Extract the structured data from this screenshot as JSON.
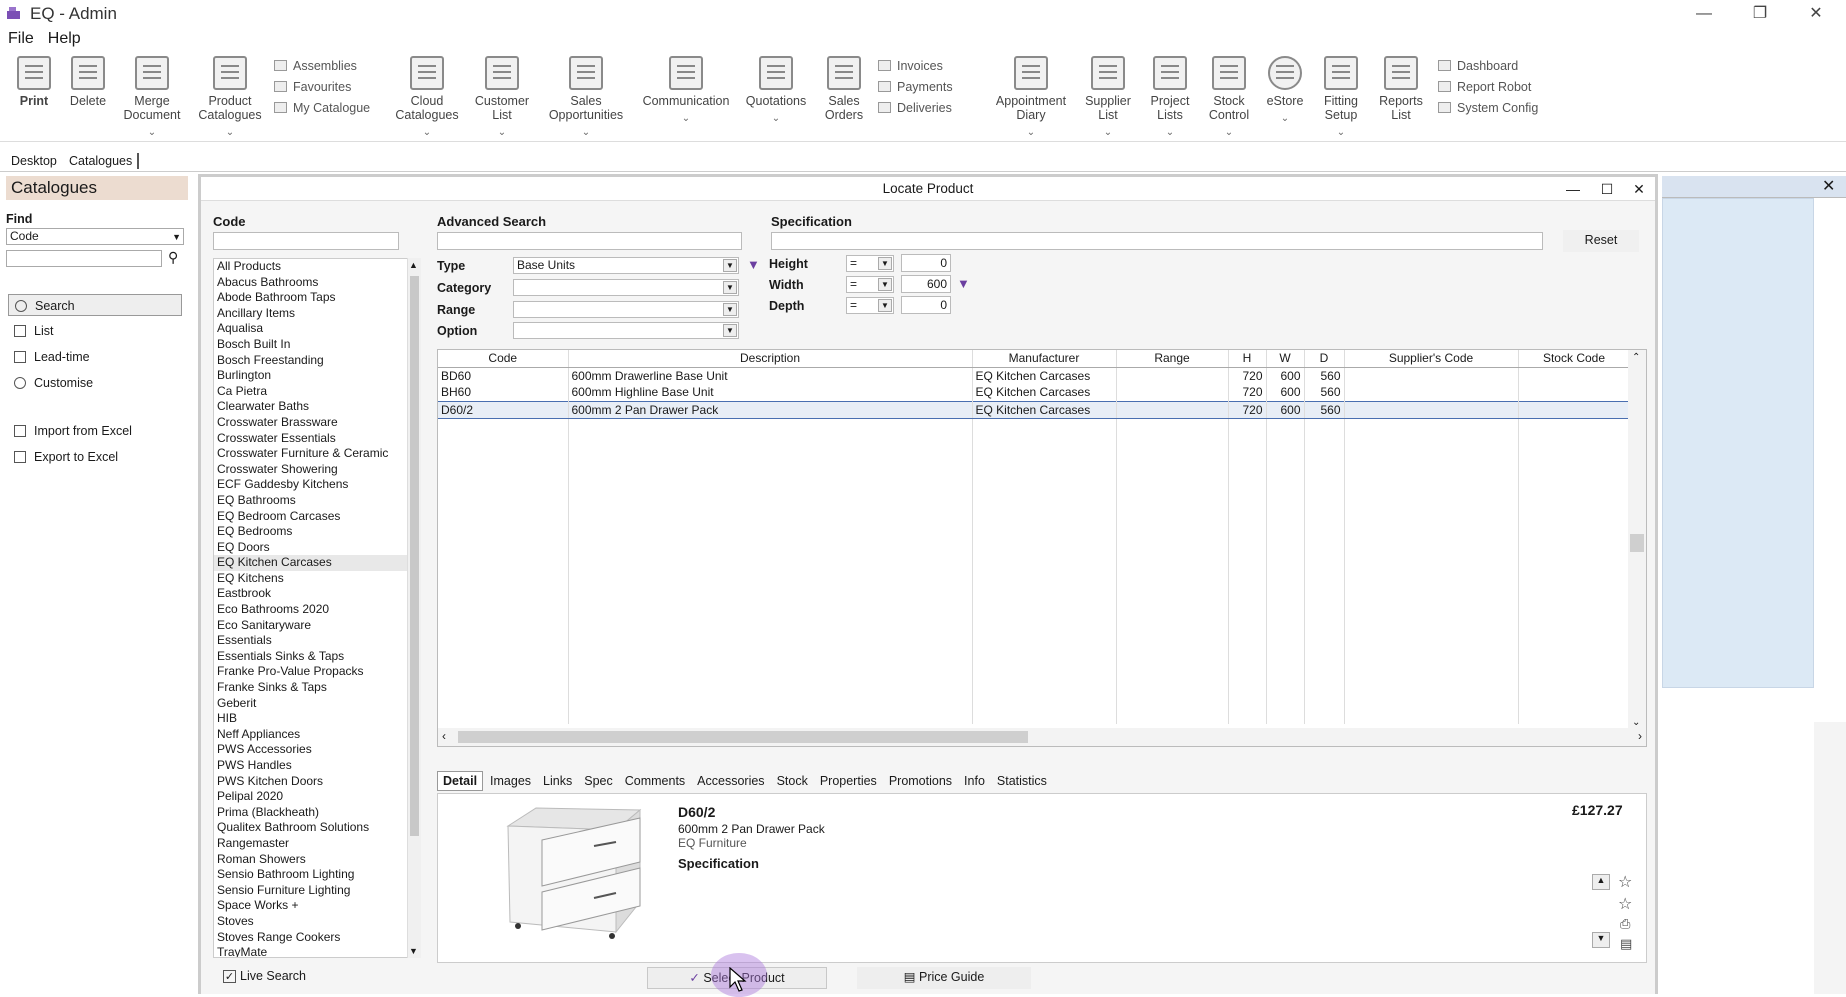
{
  "window": {
    "title": "EQ - Admin",
    "minimize": "—",
    "restore": "❐",
    "close": "✕"
  },
  "menu": [
    "File",
    "Help"
  ],
  "ribbon": {
    "print": "Print",
    "delete": "Delete",
    "merge": "Merge Document",
    "product_catalogues": "Product Catalogues",
    "assemblies": "Assemblies",
    "favourites": "Favourites",
    "my_catalogue": "My Catalogue",
    "cloud": "Cloud Catalogues",
    "customer": "Customer List",
    "sales_opp": "Sales Opportunities",
    "communication": "Communication",
    "quotations": "Quotations",
    "sales_orders": "Sales Orders",
    "invoices": "Invoices",
    "payments": "Payments",
    "deliveries": "Deliveries",
    "appointment": "Appointment Diary",
    "supplier": "Supplier List",
    "project": "Project Lists",
    "stock": "Stock Control",
    "estore": "eStore",
    "fitting": "Fitting Setup",
    "reports": "Reports List",
    "dashboard": "Dashboard",
    "report_robot": "Report Robot",
    "system_config": "System Config"
  },
  "doc_tabs": [
    "Desktop",
    "Catalogues"
  ],
  "left": {
    "title": "Catalogues",
    "find_label": "Find",
    "find_value": "Code",
    "search": "Search",
    "list": "List",
    "lead_time": "Lead-time",
    "customise": "Customise",
    "import": "Import from Excel",
    "export": "Export to Excel"
  },
  "dialog": {
    "title": "Locate Product",
    "code_label": "Code",
    "advanced_label": "Advanced Search",
    "spec_label": "Specification",
    "reset": "Reset",
    "type_label": "Type",
    "type_value": "Base Units",
    "category_label": "Category",
    "range_label": "Range",
    "option_label": "Option",
    "height_label": "Height",
    "width_label": "Width",
    "depth_label": "Depth",
    "eq": "=",
    "height_value": "0",
    "width_value": "600",
    "depth_value": "0",
    "live_search": "Live Search",
    "select_product": "Select Product",
    "price_guide": "Price Guide"
  },
  "code_list": [
    "All Products",
    "Abacus Bathrooms",
    "Abode Bathroom Taps",
    "Ancillary Items",
    "Aqualisa",
    "Bosch Built In",
    "Bosch Freestanding",
    "Burlington",
    "Ca Pietra",
    "Clearwater Baths",
    "Crosswater Brassware",
    "Crosswater Essentials",
    "Crosswater Furniture & Ceramic",
    "Crosswater Showering",
    "ECF Gaddesby Kitchens",
    "EQ Bathrooms",
    "EQ Bedroom Carcases",
    "EQ Bedrooms",
    "EQ Doors",
    "EQ Kitchen Carcases",
    "EQ Kitchens",
    "Eastbrook",
    "Eco Bathrooms 2020",
    "Eco Sanitaryware",
    "Essentials",
    "Essentials Sinks & Taps",
    "Franke Pro-Value Propacks",
    "Franke Sinks & Taps",
    "Geberit",
    "HIB",
    "Neff Appliances",
    "PWS Accessories",
    "PWS Handles",
    "PWS Kitchen Doors",
    "Pelipal 2020",
    "Prima (Blackheath)",
    "Qualitex Bathroom Solutions",
    "Rangemaster",
    "Roman Showers",
    "Sensio Bathroom Lighting",
    "Sensio Furniture Lighting",
    "Space Works +",
    "Stoves",
    "Stoves Range Cookers",
    "TrayMate"
  ],
  "grid": {
    "headers": [
      "Code",
      "Description",
      "Manufacturer",
      "Range",
      "H",
      "W",
      "D",
      "Supplier's Code",
      "Stock Code"
    ],
    "rows": [
      [
        "BD60",
        "600mm Drawerline Base Unit",
        "EQ Kitchen Carcases",
        "",
        "720",
        "600",
        "560",
        "",
        ""
      ],
      [
        "BH60",
        "600mm Highline Base Unit",
        "EQ Kitchen Carcases",
        "",
        "720",
        "600",
        "560",
        "",
        ""
      ],
      [
        "D60/2",
        "600mm 2 Pan Drawer Pack",
        "EQ Kitchen Carcases",
        "",
        "720",
        "600",
        "560",
        "",
        ""
      ]
    ]
  },
  "detail_tabs": [
    "Detail",
    "Images",
    "Links",
    "Spec",
    "Comments",
    "Accessories",
    "Stock",
    "Properties",
    "Promotions",
    "Info",
    "Statistics"
  ],
  "detail": {
    "code": "D60/2",
    "desc": "600mm 2 Pan Drawer Pack",
    "maker": "EQ Furniture",
    "spec": "Specification",
    "price": "£127.27"
  }
}
